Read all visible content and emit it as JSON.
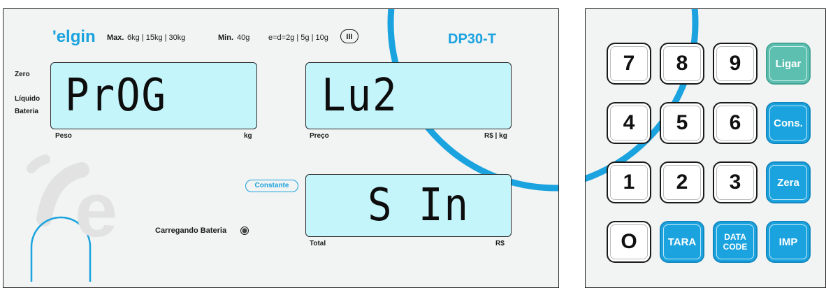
{
  "scale": {
    "brand": "'elgin",
    "specs": {
      "max_label": "Max.",
      "max_value": "6kg | 15kg | 30kg",
      "min_label": "Min.",
      "min_value": "40g",
      "e_value": "e=d=2g | 5g | 10g",
      "class_mark": "III"
    },
    "model": "DP30-T",
    "indicators": [
      "Zero",
      "Líquido",
      "Bateria"
    ],
    "displays": {
      "weight": {
        "value": "PrOG",
        "label": "Peso",
        "unit": "kg"
      },
      "price": {
        "value": "Lu2",
        "label": "Preço",
        "unit": "R$ | kg"
      },
      "total": {
        "value": "S In",
        "label": "Total",
        "unit": "R$"
      }
    },
    "constante": "Constante",
    "charging": "Carregando Bateria"
  },
  "keypad": {
    "keys": [
      {
        "label": "7",
        "style": "num"
      },
      {
        "label": "8",
        "style": "num"
      },
      {
        "label": "9",
        "style": "num"
      },
      {
        "label": "Ligar",
        "style": "teal"
      },
      {
        "label": "4",
        "style": "num"
      },
      {
        "label": "5",
        "style": "num"
      },
      {
        "label": "6",
        "style": "num"
      },
      {
        "label": "Cons.",
        "style": "blue"
      },
      {
        "label": "1",
        "style": "num"
      },
      {
        "label": "2",
        "style": "num"
      },
      {
        "label": "3",
        "style": "num"
      },
      {
        "label": "Zera",
        "style": "blue"
      },
      {
        "label": "O",
        "style": "num"
      },
      {
        "label": "TARA",
        "style": "blue"
      },
      {
        "label": "DATA\nCODE",
        "style": "blue"
      },
      {
        "label": "IMP",
        "style": "blue"
      }
    ]
  },
  "colors": {
    "lcd": "#c4f5fb",
    "accent_blue": "#1aa3de",
    "teal": "#5cbfb0",
    "panel": "#f2f3f3"
  }
}
